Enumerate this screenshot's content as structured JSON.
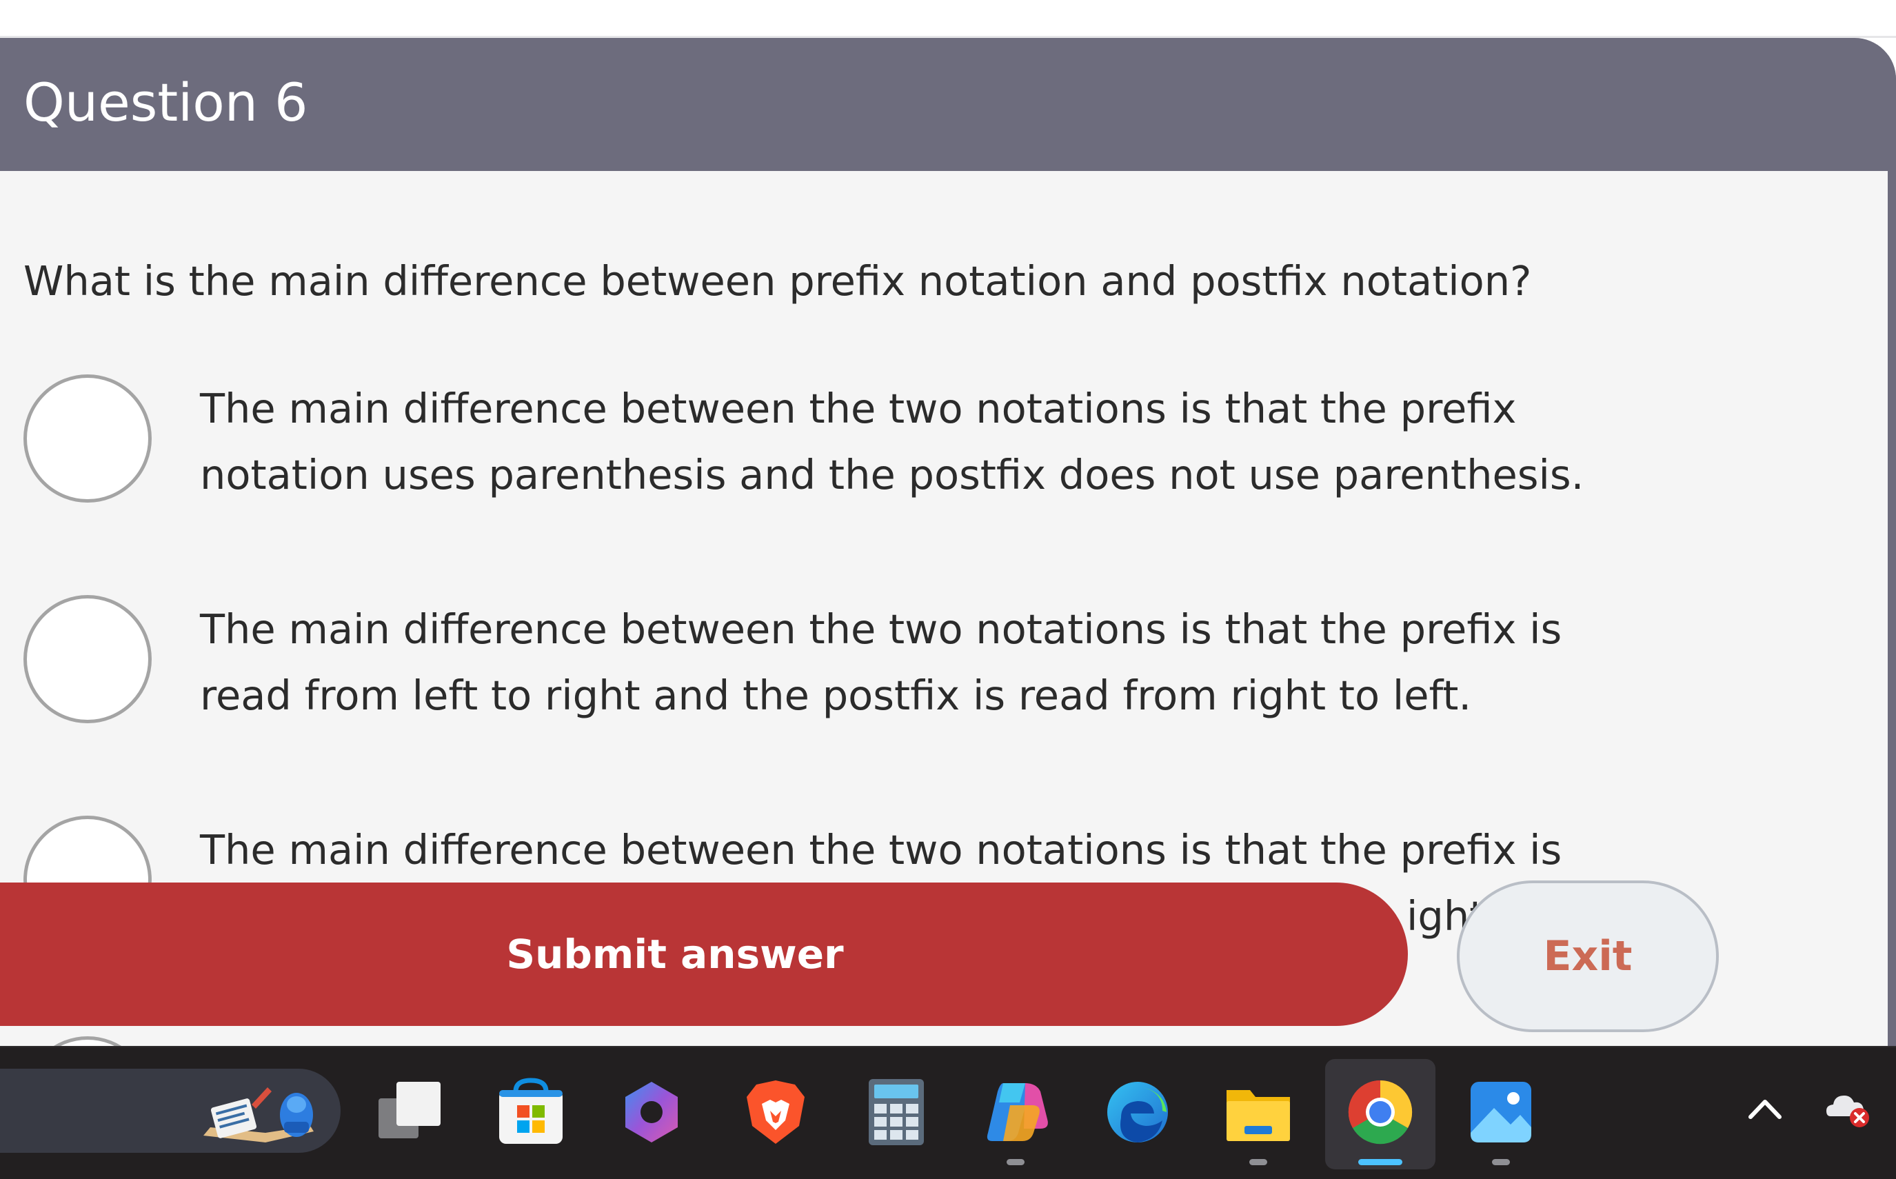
{
  "quiz": {
    "title": "Question 6",
    "question": "What is the main difference between prefix notation and postfix notation?",
    "options": [
      {
        "line1": "The main difference between the two notations is that the prefix",
        "line2": "notation uses parenthesis and the postfix does not use parenthesis."
      },
      {
        "line1": "The main difference between the two notations is that the prefix is",
        "line2": "read from left to right and the postfix is read from right to left."
      },
      {
        "line1": "The main difference between the two notations is that the prefix is",
        "line2": "ight"
      }
    ]
  },
  "actions": {
    "submit_label": "Submit answer",
    "exit_label": "Exit"
  },
  "taskbar": {
    "apps": [
      "widgets-icon",
      "task-view-icon",
      "microsoft-store-icon",
      "microsoft-365-copilot-icon",
      "brave-browser-icon",
      "calculator-icon",
      "copilot-icon",
      "edge-browser-icon",
      "file-explorer-icon",
      "chrome-browser-icon",
      "photos-icon"
    ],
    "active_app": "chrome-browser-icon",
    "tray": [
      "show-hidden-icons-chevron",
      "onedrive-error-icon"
    ]
  },
  "colors": {
    "header": "#6d6c7d",
    "submit": "#b93536",
    "exit_text": "#cc6a55",
    "taskbar": "#221f20",
    "active_indicator": "#4cc2ff"
  }
}
